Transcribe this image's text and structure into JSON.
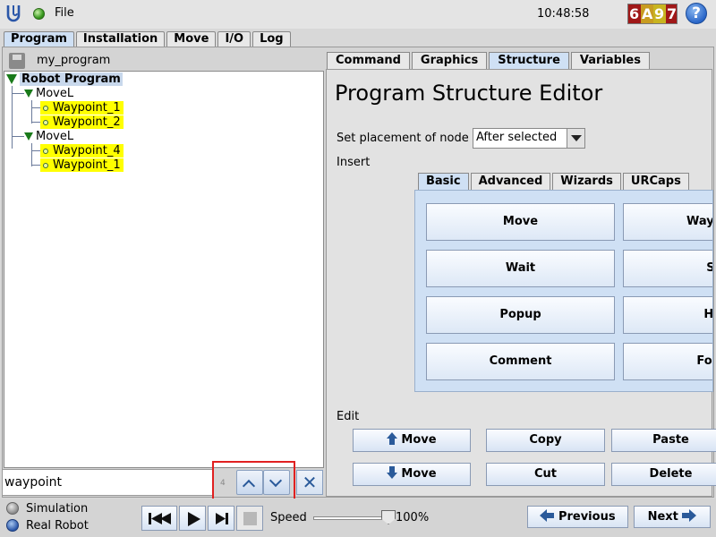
{
  "topbar": {
    "file_menu": "File",
    "clock": "10:48:58",
    "badge": [
      "6",
      "A",
      "9",
      "7"
    ],
    "help": "?"
  },
  "main_tabs": [
    {
      "label": "Program",
      "active": true
    },
    {
      "label": "Installation",
      "active": false
    },
    {
      "label": "Move",
      "active": false
    },
    {
      "label": "I/O",
      "active": false
    },
    {
      "label": "Log",
      "active": false
    }
  ],
  "program": {
    "name": "my_program",
    "tree": {
      "root": "Robot Program",
      "movel_1": "MoveL",
      "wp_1_1": "Waypoint_1",
      "wp_1_2": "Waypoint_2",
      "movel_2": "MoveL",
      "wp_2_1": "Waypoint_4",
      "wp_2_2": "Waypoint_1"
    }
  },
  "search": {
    "value": "waypoint",
    "count": "4"
  },
  "sub_tabs": [
    {
      "label": "Command",
      "active": false
    },
    {
      "label": "Graphics",
      "active": false
    },
    {
      "label": "Structure",
      "active": true
    },
    {
      "label": "Variables",
      "active": false
    }
  ],
  "editor": {
    "title": "Program Structure Editor",
    "placement_label": "Set placement of node",
    "placement_value": "After selected",
    "insert_label": "Insert",
    "edit_label": "Edit"
  },
  "insert_tabs": [
    {
      "label": "Basic",
      "active": true
    },
    {
      "label": "Advanced",
      "active": false
    },
    {
      "label": "Wizards",
      "active": false
    },
    {
      "label": "URCaps",
      "active": false
    }
  ],
  "insert_buttons": {
    "move": "Move",
    "waypoint": "Waypoint",
    "wait": "Wait",
    "set": "Set",
    "popup": "Popup",
    "halt": "Halt",
    "comment": "Comment",
    "folder": "Folder"
  },
  "edit_buttons": {
    "move_up": "Move",
    "move_down": "Move",
    "copy": "Copy",
    "cut": "Cut",
    "paste": "Paste",
    "delete": "Delete"
  },
  "bottom": {
    "simulation": "Simulation",
    "real_robot": "Real Robot",
    "speed_label": "Speed",
    "speed_value": "100%",
    "speed_fraction": 1.0,
    "previous": "Previous",
    "next": "Next"
  },
  "colors": {
    "waypoint_highlight": "#ffff00",
    "active_tab": "#cfe0f4",
    "accent": "#2a5a9a",
    "search_highlight_box": "#e02020"
  }
}
